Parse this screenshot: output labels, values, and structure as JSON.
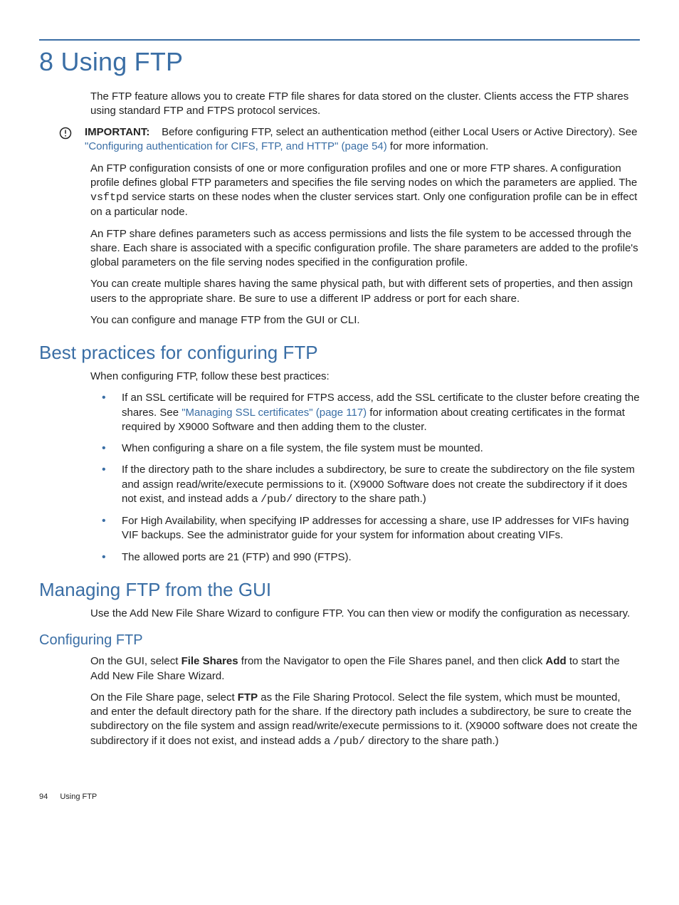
{
  "chapter": {
    "number": "8",
    "title": "Using FTP"
  },
  "intro_p1": "The FTP feature allows you to create FTP file shares for data stored on the cluster. Clients access the FTP shares using standard FTP and FTPS protocol services.",
  "admon": {
    "label": "IMPORTANT:",
    "pre": "Before configuring FTP, select an authentication method (either Local Users or Active Directory). See ",
    "link": "\"Configuring authentication for CIFS, FTP, and HTTP\" (page 54)",
    "post": " for more information."
  },
  "p2_a": "An FTP configuration consists of one or more configuration profiles and one or more FTP shares. A configuration profile defines global FTP parameters and specifies the file serving nodes on which the parameters are applied. The ",
  "p2_code": "vsftpd",
  "p2_b": " service starts on these nodes when the cluster services start. Only one configuration profile can be in effect on a particular node.",
  "p3": "An FTP share defines parameters such as access permissions and lists the file system to be accessed through the share. Each share is associated with a specific configuration profile. The share parameters are added to the profile's global parameters on the file serving nodes specified in the configuration profile.",
  "p4": "You can create multiple shares having the same physical path, but with different sets of properties, and then assign users to the appropriate share. Be sure to use a different IP address or port for each share.",
  "p5": "You can configure and manage FTP from the GUI or CLI.",
  "sec_bp": {
    "title": "Best practices for configuring FTP",
    "intro": "When configuring FTP, follow these best practices:",
    "b1_a": "If an SSL certificate will be required for FTPS access, add the SSL certificate to the cluster before creating the shares. See ",
    "b1_link": "\"Managing SSL certificates\" (page 117)",
    "b1_b": " for information about creating certificates in the format required by X9000 Software and then adding them to the cluster.",
    "b2": "When configuring a share on a file system, the file system must be mounted.",
    "b3_a": "If the directory path to the share includes a subdirectory, be sure to create the subdirectory on the file system and assign read/write/execute permissions to it. (X9000 Software does not create the subdirectory if it does not exist, and instead adds a ",
    "b3_code": "/pub/",
    "b3_b": " directory to the share path.)",
    "b4": "For High Availability, when specifying IP addresses for accessing a share, use IP addresses for VIFs having VIF backups. See the administrator guide for your system for information about creating VIFs.",
    "b5": "The allowed ports are 21 (FTP) and 990 (FTPS)."
  },
  "sec_gui": {
    "title": "Managing FTP from the GUI",
    "intro": "Use the Add New File Share Wizard to configure FTP. You can then view or modify the configuration as necessary."
  },
  "sec_conf": {
    "title": "Configuring FTP",
    "p1_a": "On the GUI, select ",
    "p1_b1": "File Shares",
    "p1_b": " from the Navigator to open the File Shares panel, and then click ",
    "p1_b2": "Add",
    "p1_c": " to start the Add New File Share Wizard.",
    "p2_a": "On the File Share page, select ",
    "p2_b1": "FTP",
    "p2_b": " as the File Sharing Protocol. Select the file system, which must be mounted, and enter the default directory path for the share. If the directory path includes a subdirectory, be sure to create the subdirectory on the file system and assign read/write/execute permissions to it. (X9000 software does not create the subdirectory if it does not exist, and instead adds a ",
    "p2_code": "/pub/",
    "p2_c": " directory to the share path.)"
  },
  "footer": {
    "page": "94",
    "title": "Using FTP"
  }
}
